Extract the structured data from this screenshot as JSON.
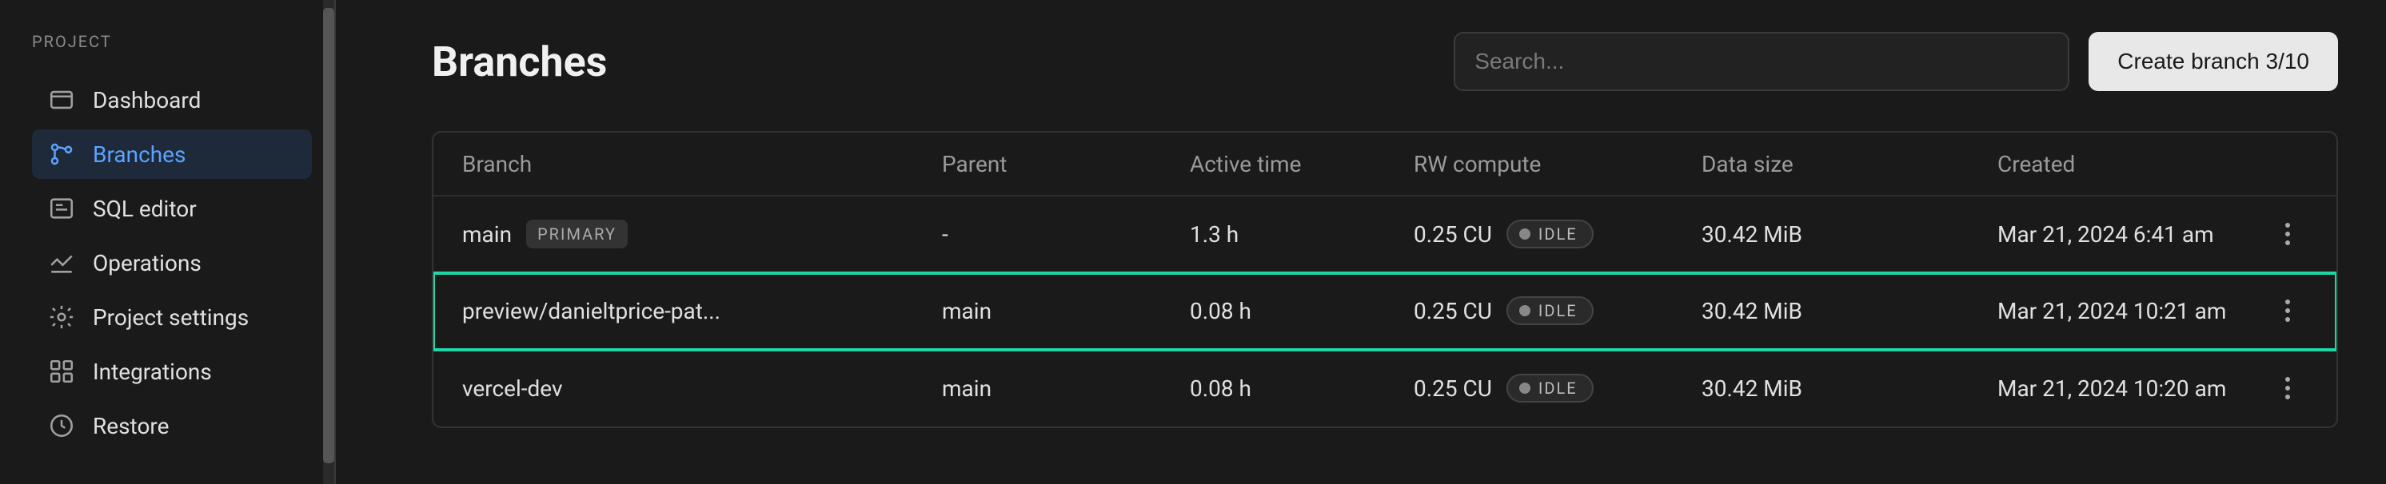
{
  "sidebar": {
    "section_label": "PROJECT",
    "items": [
      {
        "label": "Dashboard"
      },
      {
        "label": "Branches"
      },
      {
        "label": "SQL editor"
      },
      {
        "label": "Operations"
      },
      {
        "label": "Project settings"
      },
      {
        "label": "Integrations"
      },
      {
        "label": "Restore"
      }
    ]
  },
  "page": {
    "title": "Branches",
    "search_placeholder": "Search...",
    "create_button": "Create branch 3/10"
  },
  "table": {
    "headers": {
      "branch": "Branch",
      "parent": "Parent",
      "active": "Active time",
      "compute": "RW compute",
      "size": "Data size",
      "created": "Created"
    },
    "rows": [
      {
        "branch": "main",
        "primary": "PRIMARY",
        "parent": "-",
        "active": "1.3 h",
        "compute": "0.25 CU",
        "status": "IDLE",
        "size": "30.42 MiB",
        "created": "Mar 21, 2024 6:41 am"
      },
      {
        "branch": "preview/danieltprice-pat...",
        "parent": "main",
        "active": "0.08 h",
        "compute": "0.25 CU",
        "status": "IDLE",
        "size": "30.42 MiB",
        "created": "Mar 21, 2024 10:21 am"
      },
      {
        "branch": "vercel-dev",
        "parent": "main",
        "active": "0.08 h",
        "compute": "0.25 CU",
        "status": "IDLE",
        "size": "30.42 MiB",
        "created": "Mar 21, 2024 10:20 am"
      }
    ]
  }
}
